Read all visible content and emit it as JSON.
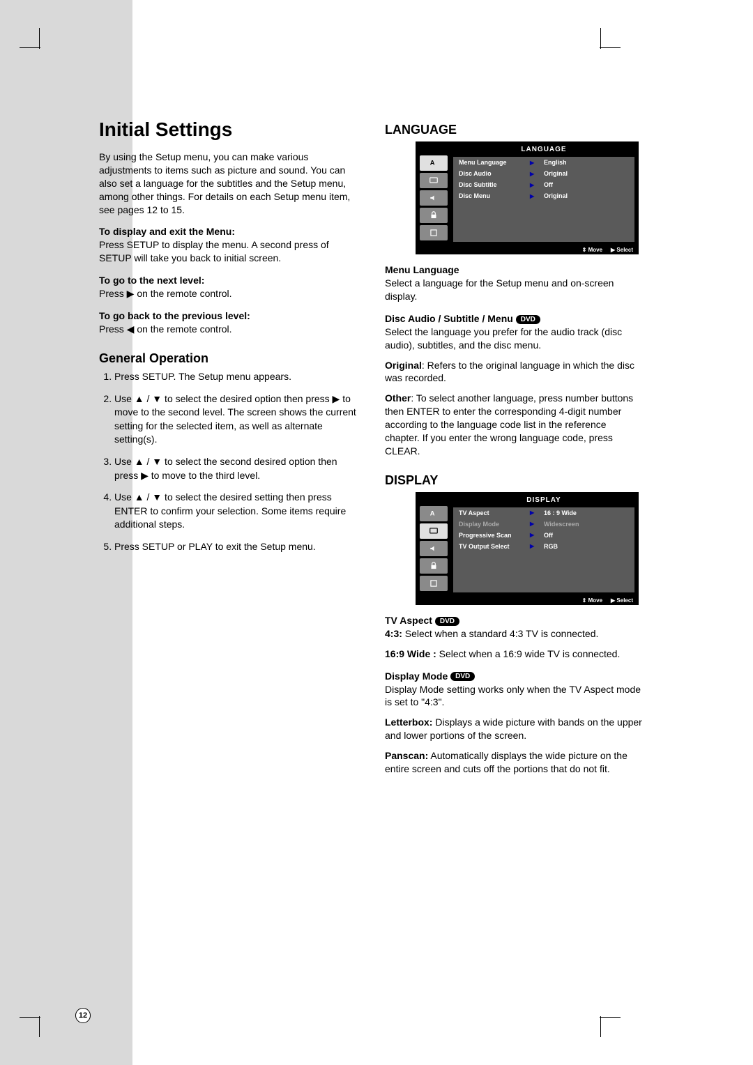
{
  "page_number": "12",
  "left": {
    "title": "Initial Settings",
    "intro": "By using the Setup menu, you can make various adjustments to items such as picture and sound. You can also set a language for the subtitles and the Setup menu, among other things. For details on each Setup menu item, see pages 12 to 15.",
    "h_display_exit": "To display and exit the Menu:",
    "p_display_exit": "Press SETUP to display the menu. A second press of SETUP will take you back to initial screen.",
    "h_next": "To go to the next level:",
    "p_next": "Press ▶ on the remote control.",
    "h_prev": "To go back to the previous level:",
    "p_prev": "Press ◀ on the remote control.",
    "h_general": "General Operation",
    "steps": [
      "Press SETUP. The Setup menu appears.",
      "Use ▲ / ▼ to select the desired option then press ▶ to move to the second level. The screen shows the current setting for the selected item, as well as alternate setting(s).",
      "Use ▲ / ▼ to select the second desired option then press ▶ to move to the third level.",
      "Use ▲ / ▼ to select the desired setting then press ENTER to confirm your selection. Some items require additional steps.",
      "Press SETUP or PLAY to exit the Setup menu."
    ]
  },
  "right": {
    "h_language": "LANGUAGE",
    "osd_lang": {
      "title": "LANGUAGE",
      "rows": [
        {
          "label": "Menu Language",
          "value": "English"
        },
        {
          "label": "Disc Audio",
          "value": "Original"
        },
        {
          "label": "Disc Subtitle",
          "value": "Off"
        },
        {
          "label": "Disc Menu",
          "value": "Original"
        }
      ],
      "footer_move": "Move",
      "footer_select": "Select"
    },
    "h_menu_lang": "Menu Language",
    "p_menu_lang": "Select a language for the Setup menu and on-screen display.",
    "h_disc_audio": "Disc Audio / Subtitle / Menu",
    "dvd_badge": "DVD",
    "p_disc_audio_1": "Select the language you prefer for the audio track (disc audio), subtitles, and the disc menu.",
    "p_original_label": "Original",
    "p_original_rest": ": Refers to the original language in which the disc was recorded.",
    "p_other_label": "Other",
    "p_other_rest": ": To select another language, press number buttons then ENTER to enter the corresponding 4-digit number according to the language code list in the reference chapter. If you enter the wrong language code, press CLEAR.",
    "h_display": "DISPLAY",
    "osd_disp": {
      "title": "DISPLAY",
      "rows": [
        {
          "label": "TV Aspect",
          "value": "16 : 9 Wide"
        },
        {
          "label": "Display Mode",
          "value": "Widescreen",
          "dim": true
        },
        {
          "label": "Progressive Scan",
          "value": "Off"
        },
        {
          "label": "TV Output Select",
          "value": "RGB"
        }
      ],
      "footer_move": "Move",
      "footer_select": "Select"
    },
    "h_tv_aspect": "TV Aspect",
    "p_43_label": "4:3:",
    "p_43_rest": " Select when a standard 4:3 TV is connected.",
    "p_169_label": "16:9 Wide :",
    "p_169_rest": " Select when a 16:9 wide TV is connected.",
    "h_disp_mode": "Display Mode",
    "p_disp_mode": "Display Mode setting works only when the TV Aspect mode is set to \"4:3\".",
    "p_letterbox_label": "Letterbox:",
    "p_letterbox_rest": " Displays a wide picture with bands on the upper and lower portions of the screen.",
    "p_panscan_label": "Panscan:",
    "p_panscan_rest": " Automatically displays the wide picture on the entire screen and cuts off the portions that do not fit."
  }
}
